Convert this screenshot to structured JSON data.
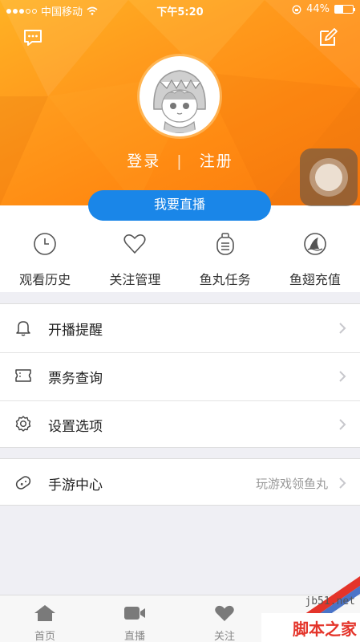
{
  "status_bar": {
    "carrier": "中国移动",
    "time": "下午5:20",
    "battery_text": "44%",
    "battery_level": 0.44
  },
  "header": {
    "login_label": "登录",
    "divider": "|",
    "register_label": "注册",
    "live_button_label": "我要直播",
    "icons": [
      "message-icon",
      "edit-icon",
      "avatar-shark-hood"
    ],
    "background_colors": [
      "#ffb224",
      "#f97a0e"
    ]
  },
  "quick_actions": [
    {
      "label": "观看历史",
      "icon": "clock-icon"
    },
    {
      "label": "关注管理",
      "icon": "heart-icon"
    },
    {
      "label": "鱼丸任务",
      "icon": "task-list-icon"
    },
    {
      "label": "鱼翅充值",
      "icon": "shark-fin-icon"
    }
  ],
  "menu_group_1": [
    {
      "label": "开播提醒",
      "icon": "bell-icon"
    },
    {
      "label": "票务查询",
      "icon": "ticket-icon"
    },
    {
      "label": "设置选项",
      "icon": "gear-icon"
    }
  ],
  "menu_group_2": [
    {
      "label": "手游中心",
      "hint": "玩游戏领鱼丸",
      "icon": "gamepad-icon"
    }
  ],
  "tab_bar": [
    {
      "label": "首页",
      "icon": "home-icon"
    },
    {
      "label": "直播",
      "icon": "video-icon"
    },
    {
      "label": "关注",
      "icon": "heart-icon"
    }
  ],
  "watermark": {
    "url": "jb51.net",
    "text": "脚本之家"
  },
  "colors": {
    "accent_blue": "#1a86e8",
    "header_orange": "#ff9a1c",
    "watermark_red": "#e4342a"
  }
}
